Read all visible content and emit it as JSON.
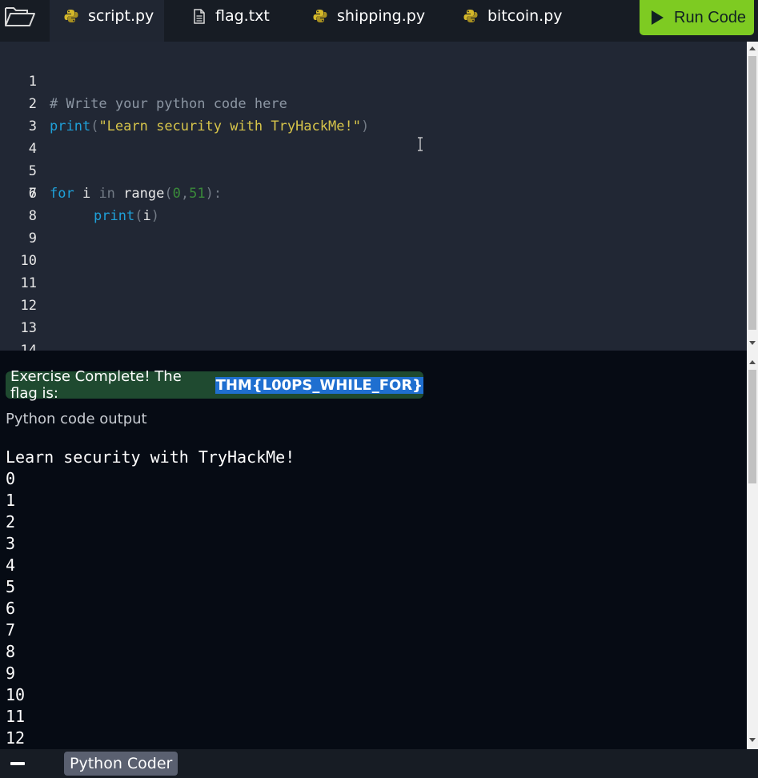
{
  "tabs": [
    {
      "label": "script.py",
      "icon": "python-icon",
      "active": true
    },
    {
      "label": "flag.txt",
      "icon": "file-icon",
      "active": false
    },
    {
      "label": "shipping.py",
      "icon": "python-icon",
      "active": false
    },
    {
      "label": "bitcoin.py",
      "icon": "python-icon",
      "active": false
    }
  ],
  "run_button": {
    "label": "Run Code",
    "color": "#7ecb22"
  },
  "editor": {
    "line_numbers": [
      "1",
      "2",
      "3",
      "4",
      "5",
      "6",
      "7",
      "8",
      "9",
      "10",
      "11",
      "12",
      "13",
      "14"
    ],
    "code": {
      "l1_comment": "# Write your python code here",
      "l2_kw": "print",
      "l2_open": "(",
      "l2_str": "\"Learn security with TryHackMe!\"",
      "l2_close": ")",
      "l5_kw": "for",
      "l5_var": " i ",
      "l5_in": "in",
      "l5_fn": " range",
      "l5_open": "(",
      "l5_n1": "0",
      "l5_comma": ",",
      "l5_n2": "51",
      "l5_close": "):",
      "l6_kw": "print",
      "l6_open": "(",
      "l6_arg": "i",
      "l6_close": ")"
    }
  },
  "output": {
    "banner_text": "Exercise Complete! The flag is:",
    "flag": "THM{L00PS_WHILE_FOR}",
    "title": "Python code output",
    "lines": [
      "Learn security with TryHackMe!",
      "0",
      "1",
      "2",
      "3",
      "4",
      "5",
      "6",
      "7",
      "8",
      "9",
      "10",
      "11",
      "12"
    ]
  },
  "statusbar": {
    "app_label": "Python Coder"
  }
}
